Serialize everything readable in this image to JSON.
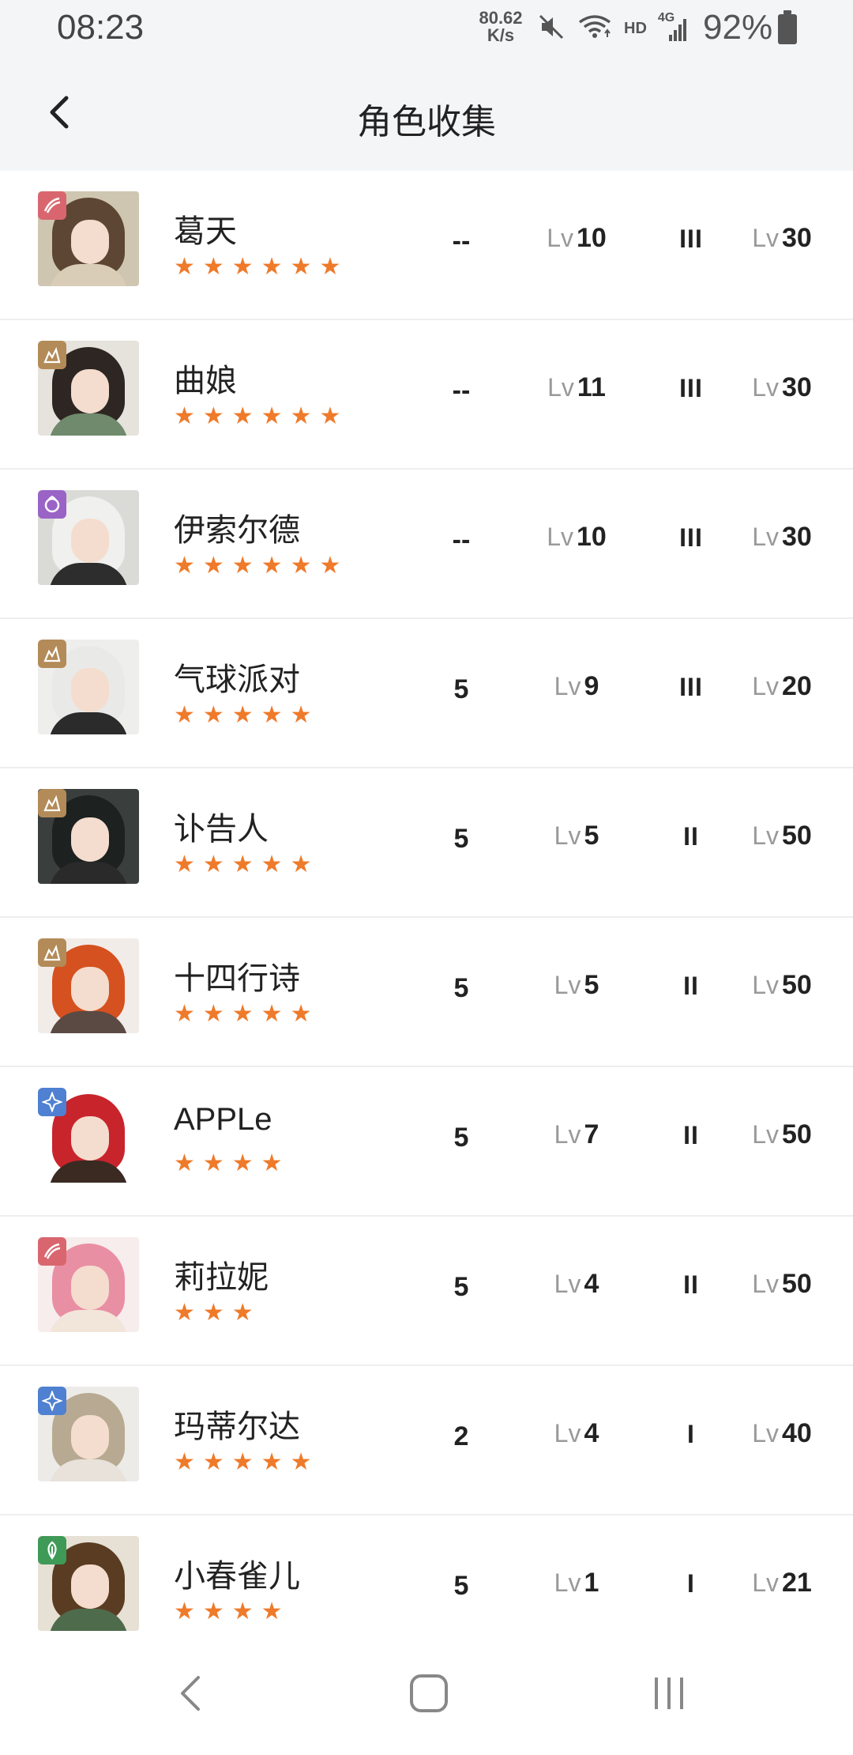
{
  "status_bar": {
    "time": "08:23",
    "net_speed_value": "80.62",
    "net_speed_unit": "K/s",
    "network_label": "HD",
    "network_type": "4G",
    "battery": "92%"
  },
  "header": {
    "title": "角色收集",
    "back_icon": "chevron-left-icon"
  },
  "colors": {
    "star": "#ef7a2a",
    "badge_red": "#d9666f",
    "badge_gold": "#b38b58",
    "badge_purple": "#9a63c6",
    "badge_blue": "#4f80d1",
    "badge_green": "#3f9a57"
  },
  "characters": [
    {
      "name": "葛天",
      "stars": "★★★★★★",
      "rarity": 6,
      "col_a": "--",
      "lv_label": "Lv",
      "level": "10",
      "tier": "III",
      "lv2_label": "Lv",
      "level2": "30",
      "badge": "red"
    },
    {
      "name": "曲娘",
      "stars": "★★★★★★",
      "rarity": 6,
      "col_a": "--",
      "lv_label": "Lv",
      "level": "11",
      "tier": "III",
      "lv2_label": "Lv",
      "level2": "30",
      "badge": "gold"
    },
    {
      "name": "伊索尔德",
      "stars": "★★★★★★",
      "rarity": 6,
      "col_a": "--",
      "lv_label": "Lv",
      "level": "10",
      "tier": "III",
      "lv2_label": "Lv",
      "level2": "30",
      "badge": "purple"
    },
    {
      "name": "气球派对",
      "stars": "★★★★★",
      "rarity": 5,
      "col_a": "5",
      "lv_label": "Lv",
      "level": "9",
      "tier": "III",
      "lv2_label": "Lv",
      "level2": "20",
      "badge": "gold"
    },
    {
      "name": "讣告人",
      "stars": "★★★★★",
      "rarity": 5,
      "col_a": "5",
      "lv_label": "Lv",
      "level": "5",
      "tier": "II",
      "lv2_label": "Lv",
      "level2": "50",
      "badge": "gold"
    },
    {
      "name": "十四行诗",
      "stars": "★★★★★",
      "rarity": 5,
      "col_a": "5",
      "lv_label": "Lv",
      "level": "5",
      "tier": "II",
      "lv2_label": "Lv",
      "level2": "50",
      "badge": "gold"
    },
    {
      "name": "APPLe",
      "stars": "★★★★",
      "rarity": 4,
      "col_a": "5",
      "lv_label": "Lv",
      "level": "7",
      "tier": "II",
      "lv2_label": "Lv",
      "level2": "50",
      "badge": "blue"
    },
    {
      "name": "莉拉妮",
      "stars": "★★★",
      "rarity": 3,
      "col_a": "5",
      "lv_label": "Lv",
      "level": "4",
      "tier": "II",
      "lv2_label": "Lv",
      "level2": "50",
      "badge": "red"
    },
    {
      "name": "玛蒂尔达",
      "stars": "★★★★★",
      "rarity": 5,
      "col_a": "2",
      "lv_label": "Lv",
      "level": "4",
      "tier": "I",
      "lv2_label": "Lv",
      "level2": "40",
      "badge": "blue"
    },
    {
      "name": "小春雀儿",
      "stars": "★★★★",
      "rarity": 4,
      "col_a": "5",
      "lv_label": "Lv",
      "level": "1",
      "tier": "I",
      "lv2_label": "Lv",
      "level2": "21",
      "badge": "green"
    }
  ],
  "nav_bar": {
    "back_icon": "nav-back-icon",
    "home_icon": "nav-home-icon",
    "recents_icon": "nav-recents-icon"
  }
}
